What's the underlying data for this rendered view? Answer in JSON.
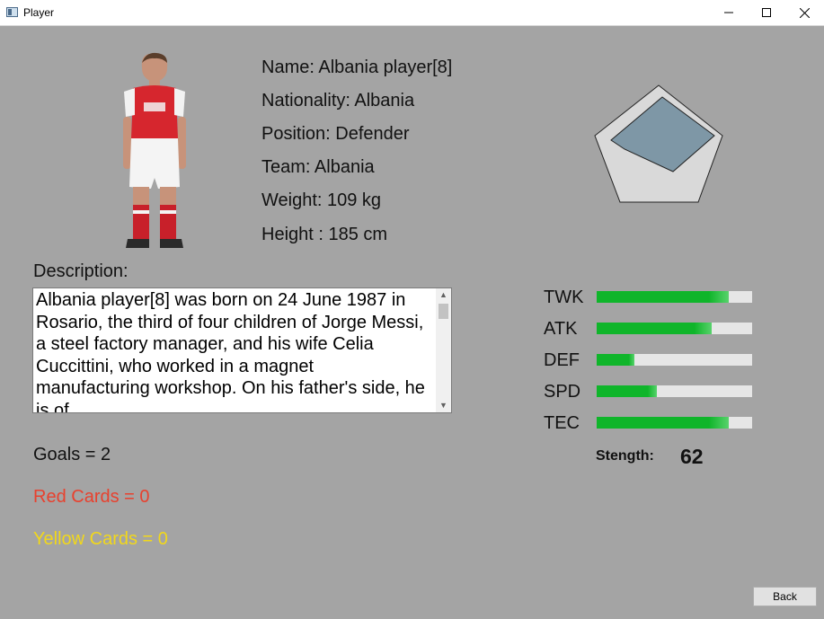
{
  "window": {
    "title": "Player",
    "icon": "app-window-icon",
    "controls": [
      "minimize-icon",
      "maximize-icon",
      "close-icon"
    ]
  },
  "player": {
    "name_line": "Name: Albania player[8]",
    "nationality_line": "Nationality: Albania",
    "position_line": "Position: Defender",
    "team_line": "Team: Albania",
    "weight_line": "Weight: 109 kg",
    "height_line": "Height : 185 cm"
  },
  "description": {
    "label": "Description:",
    "text": "Albania player[8] was born on 24 June 1987 in Rosario, the third of four children of Jorge Messi, a steel factory manager, and his wife Celia Cuccittini, who worked in a magnet manufacturing workshop. On his father's side, he is of"
  },
  "stats": [
    {
      "label": "TWK",
      "fraction": 0.85
    },
    {
      "label": "ATK",
      "fraction": 0.74
    },
    {
      "label": "DEF",
      "fraction": 0.24
    },
    {
      "label": "SPD",
      "fraction": 0.39
    },
    {
      "label": "TEC",
      "fraction": 0.85
    }
  ],
  "strength": {
    "label": "Stength:",
    "value": "62"
  },
  "record": {
    "goals": "Goals = 2",
    "red_cards": "Red Cards = 0",
    "yellow_cards": "Yellow Cards = 0"
  },
  "colors": {
    "red_cards": "#e8412e",
    "yellow_cards": "#f2d81a",
    "stat_fill": "#0fb52a",
    "radar_fill": "#7e97a6"
  },
  "back_button": {
    "label": "Back"
  }
}
